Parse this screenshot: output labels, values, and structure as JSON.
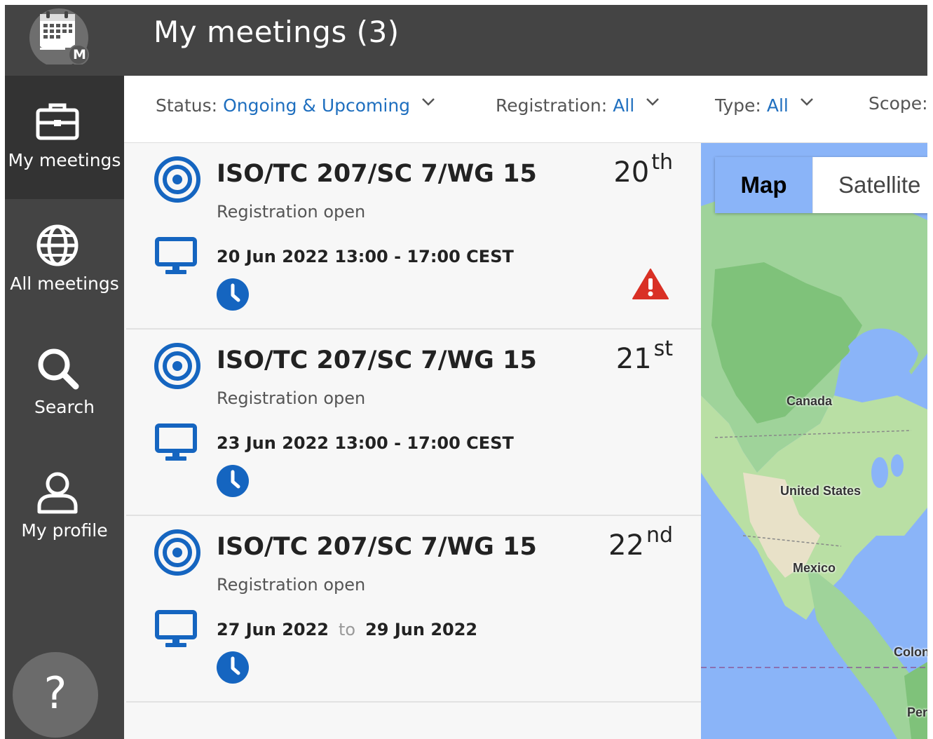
{
  "header": {
    "title": "My meetings (3)",
    "logo_badge": "M"
  },
  "sidebar": {
    "items": [
      {
        "label": "My meetings",
        "icon": "briefcase-icon",
        "active": true
      },
      {
        "label": "All meetings",
        "icon": "globe-icon",
        "active": false
      },
      {
        "label": "Search",
        "icon": "search-icon",
        "active": false
      },
      {
        "label": "My profile",
        "icon": "user-icon",
        "active": false
      }
    ],
    "help_label": "?"
  },
  "filters": [
    {
      "label": "Status:",
      "value": "Ongoing & Upcoming"
    },
    {
      "label": "Registration:",
      "value": "All"
    },
    {
      "label": "Type:",
      "value": "All"
    },
    {
      "label": "Scope:",
      "value": ""
    }
  ],
  "meetings": [
    {
      "title": "ISO/TC 207/SC 7/WG 15",
      "status": "Registration open",
      "dates": "20 Jun 2022 13:00 - 17:00 CEST",
      "date_to": "",
      "date_end": "",
      "day": "20",
      "day_suffix": "th",
      "warning": true
    },
    {
      "title": "ISO/TC 207/SC 7/WG 15",
      "status": "Registration open",
      "dates": "23 Jun 2022 13:00 - 17:00 CEST",
      "date_to": "",
      "date_end": "",
      "day": "21",
      "day_suffix": "st",
      "warning": false
    },
    {
      "title": "ISO/TC 207/SC 7/WG 15",
      "status": "Registration open",
      "dates": "27 Jun 2022",
      "date_to": "to",
      "date_end": "29 Jun 2022",
      "day": "22",
      "day_suffix": "nd",
      "warning": false
    }
  ],
  "map": {
    "toggle": {
      "map_label": "Map",
      "satellite_label": "Satellite"
    },
    "labels": {
      "canada": "Canada",
      "united_states": "United States",
      "mexico": "Mexico",
      "colombia": "Colon",
      "peru": "Per"
    }
  },
  "colors": {
    "accent": "#1f6fbf",
    "icon_blue": "#1565c0",
    "warning": "#d93025",
    "dark": "#444444"
  }
}
